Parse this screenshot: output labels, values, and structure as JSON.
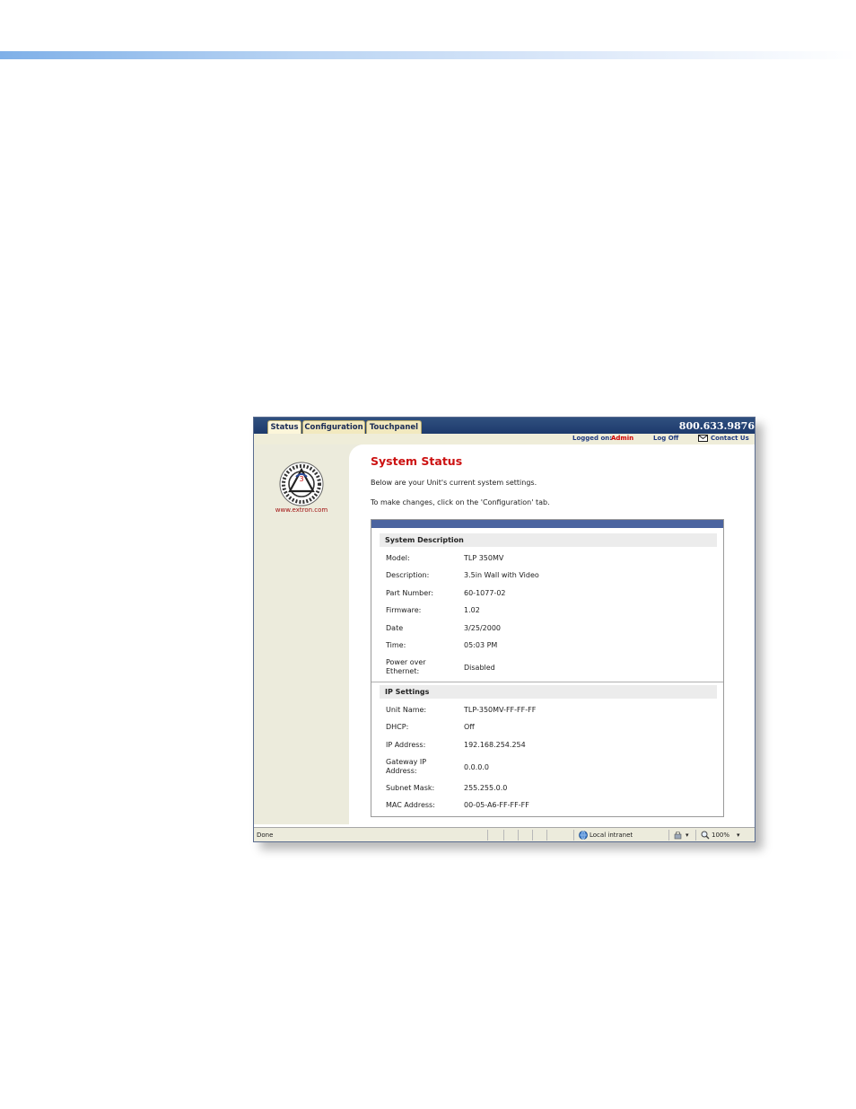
{
  "tabs": [
    {
      "label": "Status"
    },
    {
      "label": "Configuration"
    },
    {
      "label": "Touchpanel"
    }
  ],
  "header": {
    "phone": "800.633.9876"
  },
  "userbar": {
    "logged_on_label": "Logged on:",
    "user": "Admin",
    "logoff": "Log Off",
    "contact": "Contact Us"
  },
  "sidebar": {
    "website": "www.extron.com"
  },
  "page": {
    "title": "System Status",
    "intro1": "Below are your Unit's current system settings.",
    "intro2": "To make changes, click on the 'Configuration' tab."
  },
  "system_description": {
    "heading": "System Description",
    "rows": [
      {
        "label": "Model:",
        "value": "TLP 350MV"
      },
      {
        "label": "Description:",
        "value": "3.5in Wall with Video"
      },
      {
        "label": "Part Number:",
        "value": "60-1077-02"
      },
      {
        "label": "Firmware:",
        "value": "1.02"
      },
      {
        "label": "Date",
        "value": "3/25/2000"
      },
      {
        "label": "Time:",
        "value": "05:03 PM"
      },
      {
        "label": "Power over Ethernet:",
        "value": "Disabled"
      }
    ]
  },
  "ip_settings": {
    "heading": "IP Settings",
    "rows": [
      {
        "label": "Unit Name:",
        "value": "TLP-350MV-FF-FF-FF"
      },
      {
        "label": "DHCP:",
        "value": "Off"
      },
      {
        "label": "IP Address:",
        "value": "192.168.254.254"
      },
      {
        "label": "Gateway IP Address:",
        "value": "0.0.0.0"
      },
      {
        "label": "Subnet Mask:",
        "value": "255.255.0.0"
      },
      {
        "label": "MAC Address:",
        "value": "00-05-A6-FF-FF-FF"
      }
    ]
  },
  "statusbar": {
    "status": "Done",
    "zone": "Local intranet",
    "zoom": "100%"
  },
  "colors": {
    "accent_red": "#cc1111",
    "header_blue": "#1d3a6c",
    "panel_blue": "#4b64a0"
  }
}
